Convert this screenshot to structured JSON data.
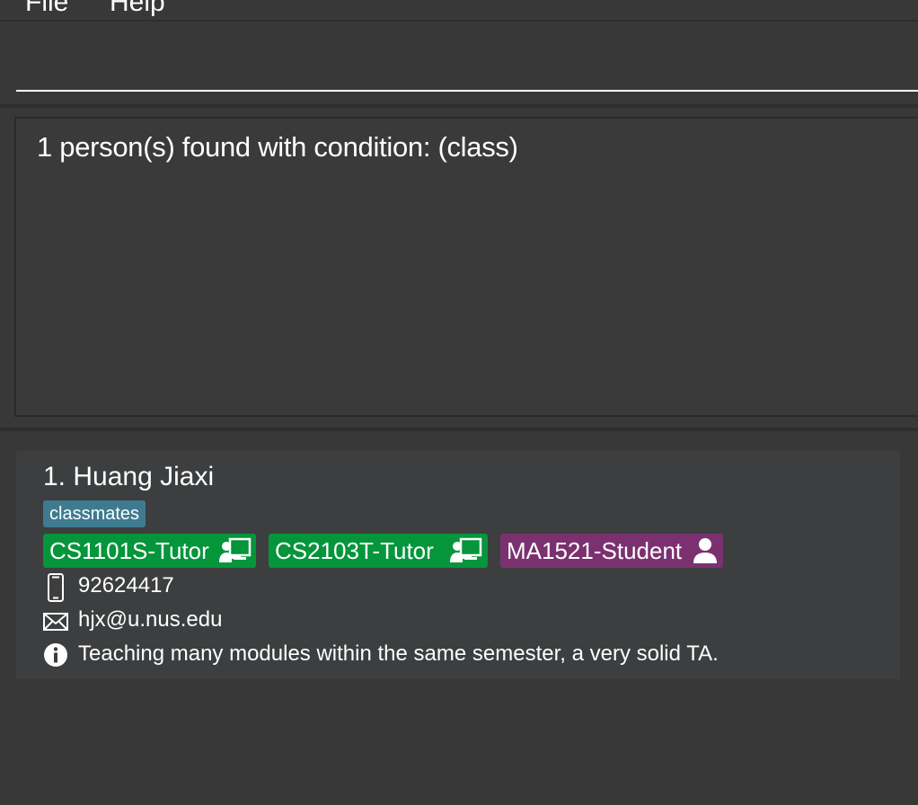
{
  "menu": {
    "file": "File",
    "help": "Help"
  },
  "command_box": {
    "value": "",
    "placeholder": ""
  },
  "result": {
    "message": "1 person(s) found with condition: (class)"
  },
  "persons": [
    {
      "index": "1.",
      "name": "Huang Jiaxi",
      "tags": [
        "classmates"
      ],
      "roles": [
        {
          "label": "CS1101S-Tutor",
          "kind": "tutor",
          "color": "#05953b",
          "icon": "teacher-icon"
        },
        {
          "label": "CS2103T-Tutor",
          "kind": "tutor",
          "color": "#05953b",
          "icon": "teacher-icon"
        },
        {
          "label": "MA1521-Student",
          "kind": "student",
          "color": "#7b3170",
          "icon": "student-icon"
        }
      ],
      "phone": "92624417",
      "email": "hjx@u.nus.edu",
      "remark": "Teaching many modules within the same semester, a very solid TA."
    }
  ],
  "colors": {
    "background": "#383838",
    "card": "#3c3e3f",
    "tag": "#3e7b91",
    "tutor": "#05953b",
    "student": "#7b3170"
  }
}
